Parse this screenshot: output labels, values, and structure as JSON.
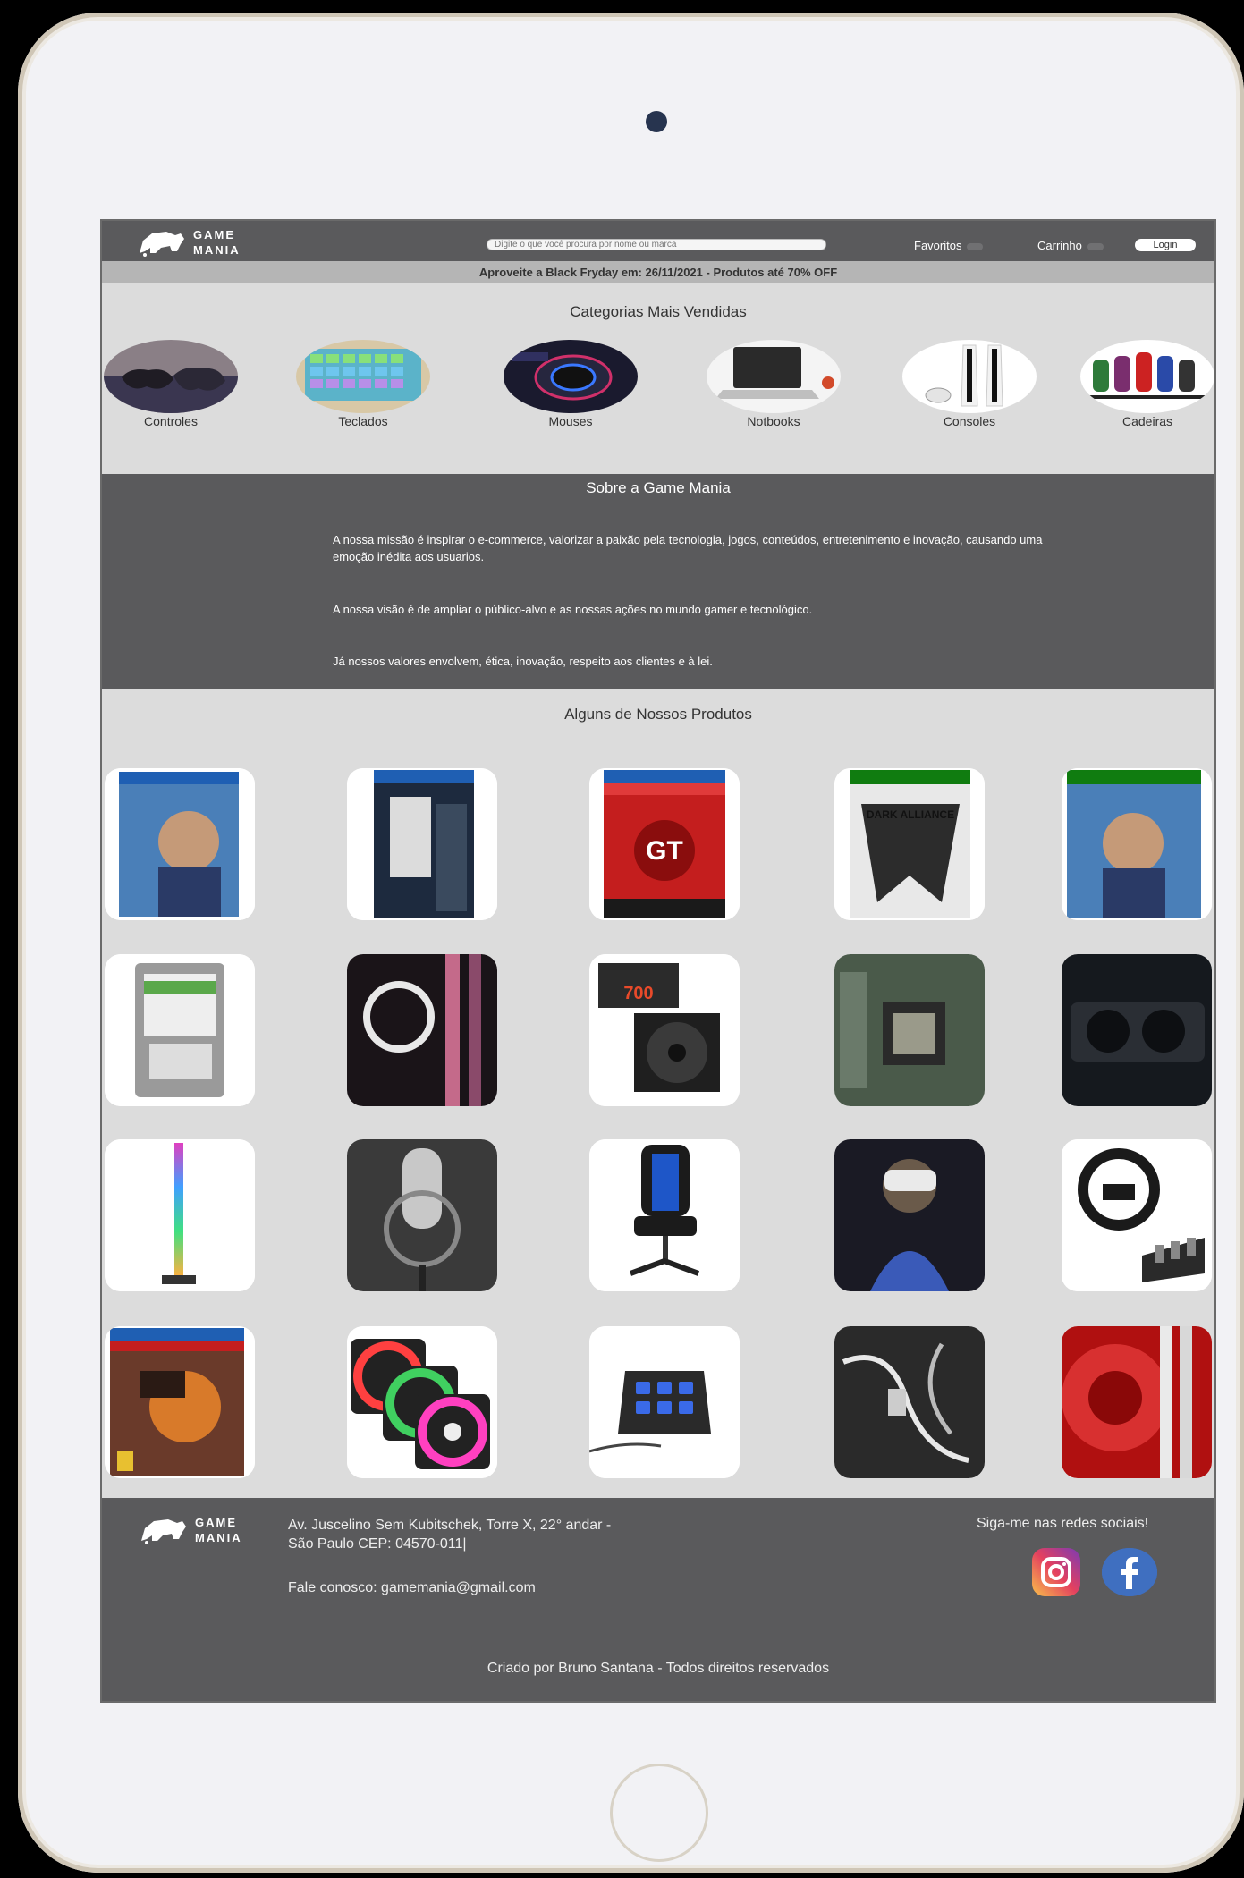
{
  "header": {
    "logo_text_line1": "GAME",
    "logo_text_line2": "MANIA",
    "search_placeholder": "Digite o que você procura por nome ou marca",
    "favorites_label": "Favoritos",
    "cart_label": "Carrinho",
    "login_label": "Login"
  },
  "promo": {
    "text": "Aproveite a Black Fryday em: 26/11/2021 - Produtos até 70% OFF"
  },
  "categories": {
    "title": "Categorias Mais Vendidas",
    "items": [
      {
        "label": "Controles"
      },
      {
        "label": "Teclados"
      },
      {
        "label": "Mouses"
      },
      {
        "label": "Notbooks"
      },
      {
        "label": "Consoles"
      },
      {
        "label": "Cadeiras"
      }
    ]
  },
  "about": {
    "title": "Sobre a Game Mania",
    "mission": "A nossa missão é inspirar o e-commerce, valorizar a paixão pela tecnologia, jogos, conteúdos, entretenimento e inovação, causando uma emoção inédita aos usuarios.",
    "vision": "A nossa visão é de ampliar o público-alvo e as nossas ações no mundo gamer e tecnológico.",
    "values": "Já nossos valores envolvem, ética, inovação, respeito aos clientes e à lei."
  },
  "products": {
    "title": "Alguns de Nossos Produtos"
  },
  "footer": {
    "logo_text_line1": "GAME",
    "logo_text_line2": "MANIA",
    "address_line1": "Av. Juscelino Sem Kubitschek,  Torre X, 22° andar -",
    "address_line2": "São Paulo CEP: 04570-011|",
    "contact": "Fale conosco: gamemania@gmail.com",
    "social_title": "Siga-me nas redes sociais!",
    "copyright": "Criado por Bruno Santana - Todos direitos reservados"
  },
  "colors": {
    "header_bg": "#5a5a5c",
    "promo_bg": "#b5b5b5",
    "page_bg": "#dcdcdc",
    "facebook": "#3f6fc0"
  }
}
